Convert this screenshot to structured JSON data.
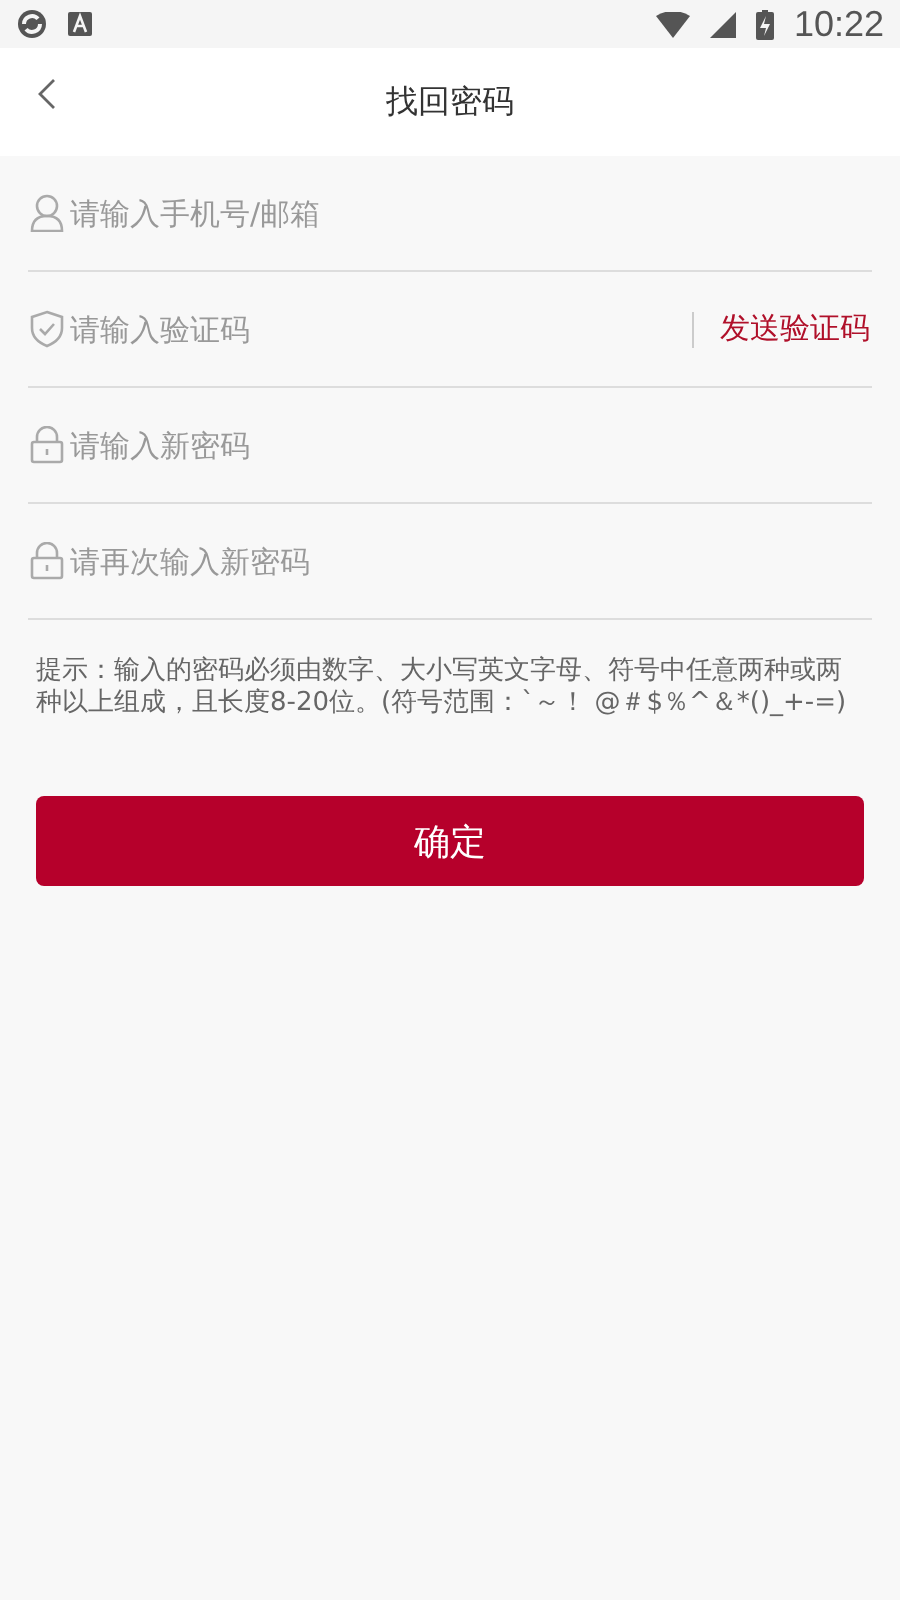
{
  "status_bar": {
    "time": "10:22"
  },
  "header": {
    "title": "找回密码"
  },
  "fields": [
    {
      "kind": "user",
      "placeholder": "请输入手机号/邮箱"
    },
    {
      "kind": "shield",
      "placeholder": "请输入验证码",
      "action": "发送验证码"
    },
    {
      "kind": "lock",
      "placeholder": "请输入新密码"
    },
    {
      "kind": "lock",
      "placeholder": "请再次输入新密码"
    }
  ],
  "hint": "提示：输入的密码必须由数字、大小写英文字母、符号中任意两种或两种以上组成，且长度8-20位。(符号范围：`～！ @＃$％^＆*()_+-=)",
  "submit": "确定"
}
